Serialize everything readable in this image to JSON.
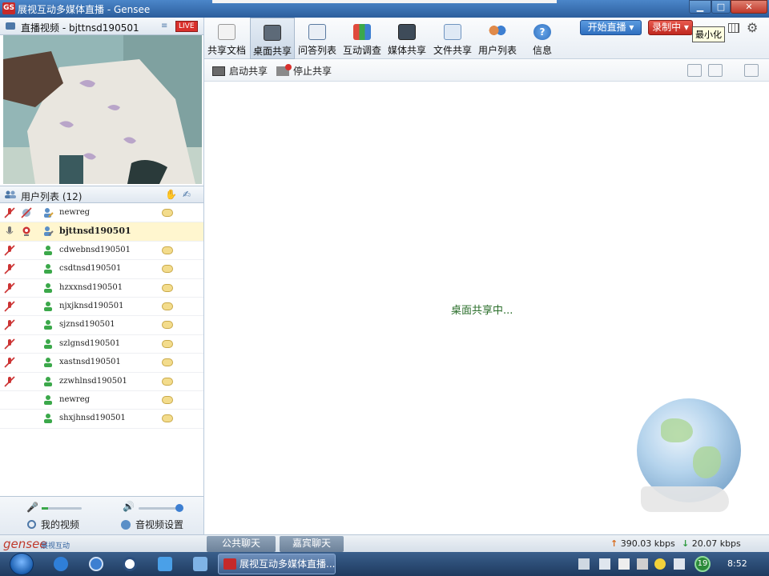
{
  "window": {
    "title": "展视互动多媒体直播 - Gensee",
    "app_icon": "GS"
  },
  "video_panel": {
    "title": "直播视频 - bjttnsd190501",
    "live_badge": "LIVE"
  },
  "user_list": {
    "title": "用户列表 (12)",
    "users": [
      {
        "name": "newreg"
      },
      {
        "name": "bjttnsd190501"
      },
      {
        "name": "cdwebnsd190501"
      },
      {
        "name": "csdtnsd190501"
      },
      {
        "name": "hzxxnsd190501"
      },
      {
        "name": "njxjknsd190501"
      },
      {
        "name": "sjznsd190501"
      },
      {
        "name": "szlgnsd190501"
      },
      {
        "name": "xastnsd190501"
      },
      {
        "name": "zzwhlnsd190501"
      },
      {
        "name": "newreg"
      },
      {
        "name": "shxjhnsd190501"
      }
    ]
  },
  "left_bottom": {
    "my_video": "我的视频",
    "av_settings": "音视频设置"
  },
  "toolbar": {
    "items": [
      {
        "label": "共享文档",
        "icon": "document-icon"
      },
      {
        "label": "桌面共享",
        "icon": "desktop-share-icon"
      },
      {
        "label": "问答列表",
        "icon": "qa-icon"
      },
      {
        "label": "互动调查",
        "icon": "survey-icon"
      },
      {
        "label": "媒体共享",
        "icon": "media-icon"
      },
      {
        "label": "文件共享",
        "icon": "file-share-icon"
      },
      {
        "label": "用户列表",
        "icon": "users-icon"
      },
      {
        "label": "信息",
        "icon": "info-icon"
      }
    ],
    "start_live": "开始直播",
    "recording": "录制中",
    "tooltip": "最小化"
  },
  "subbar": {
    "start_share": "启动共享",
    "stop_share": "停止共享"
  },
  "main": {
    "status": "桌面共享中..."
  },
  "bottom": {
    "logo": "gensee",
    "logo_sub": "展视互动",
    "public_chat": "公共聊天",
    "guest_chat": "嘉宾聊天",
    "upload": "390.03 kbps",
    "download": "20.07 kbps"
  },
  "taskbar": {
    "app_label": "展视互动多媒体直播...",
    "badge": "19",
    "clock": "8:52"
  },
  "colors": {
    "accent_blue": "#2f6fbf",
    "recording_red": "#c0281f",
    "status_green": "#2a6e2a"
  }
}
